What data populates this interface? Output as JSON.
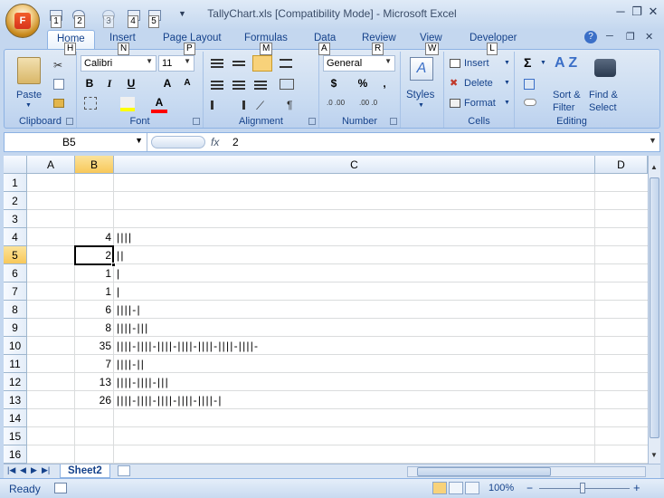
{
  "window": {
    "title": "TallyChart.xls  [Compatibility Mode] - Microsoft Excel",
    "office_logo": "F",
    "minimize": "─",
    "restore": "❐",
    "close": "✕"
  },
  "keytips": {
    "qat1": "1",
    "qat2": "2",
    "qat3": "3",
    "qat4": "4",
    "qat5": "5",
    "home": "H",
    "insert": "N",
    "page_layout": "P",
    "formulas": "M",
    "data": "A",
    "review": "R",
    "view": "W",
    "developer": "L"
  },
  "tabs": [
    "Home",
    "Insert",
    "Page Layout",
    "Formulas",
    "Data",
    "Review",
    "View",
    "Developer"
  ],
  "ribbon": {
    "clipboard": {
      "label": "Clipboard",
      "paste": "Paste"
    },
    "font": {
      "label": "Font",
      "name": "Calibri",
      "size": "11",
      "bold": "B",
      "italic": "I",
      "underline": "U",
      "grow": "A",
      "shrink": "A",
      "color": "A"
    },
    "alignment": {
      "label": "Alignment"
    },
    "number": {
      "label": "Number",
      "format": "General",
      "currency": "$",
      "percent": "%",
      "comma": ","
    },
    "styles": {
      "label": "Styles"
    },
    "cells": {
      "label": "Cells",
      "insert": "Insert",
      "delete": "Delete",
      "format": "Format"
    },
    "editing": {
      "label": "Editing",
      "sort": "Sort &",
      "filter": "Filter",
      "find": "Find &",
      "select": "Select",
      "sigma": "Σ"
    }
  },
  "formula_bar": {
    "name_box": "B5",
    "fx": "fx",
    "value": "2"
  },
  "columns": [
    "A",
    "B",
    "C",
    "D"
  ],
  "rows": [
    "1",
    "2",
    "3",
    "4",
    "5",
    "6",
    "7",
    "8",
    "9",
    "10",
    "11",
    "12",
    "13",
    "14",
    "15",
    "16"
  ],
  "cells": [
    {
      "row": "4",
      "value": "4",
      "tally": "||||"
    },
    {
      "row": "5",
      "value": "2",
      "tally": "||"
    },
    {
      "row": "6",
      "value": "1",
      "tally": "|"
    },
    {
      "row": "7",
      "value": "1",
      "tally": "|"
    },
    {
      "row": "8",
      "value": "6",
      "tally": "||||-|"
    },
    {
      "row": "9",
      "value": "8",
      "tally": "||||-|||"
    },
    {
      "row": "10",
      "value": "35",
      "tally": "||||-||||-||||-||||-||||-||||-||||-"
    },
    {
      "row": "11",
      "value": "7",
      "tally": "||||-||"
    },
    {
      "row": "12",
      "value": "13",
      "tally": "||||-||||-|||"
    },
    {
      "row": "13",
      "value": "26",
      "tally": "||||-||||-||||-||||-||||-|"
    }
  ],
  "sheet": {
    "tab": "Sheet2"
  },
  "status": {
    "ready": "Ready",
    "zoom": "100%",
    "minus": "−",
    "plus": "+"
  }
}
